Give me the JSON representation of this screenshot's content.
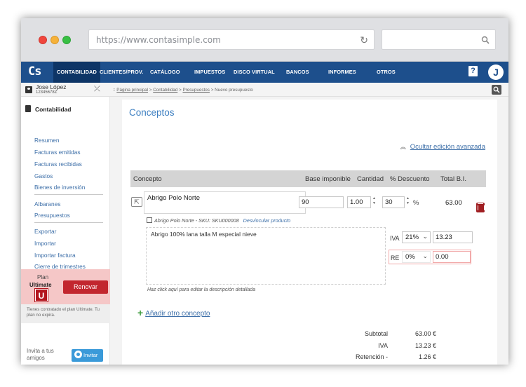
{
  "browser": {
    "url": "https://www.contasimple.com"
  },
  "nav": {
    "logo": "Cs",
    "items": [
      "CONTABILIDAD",
      "CLIENTES/PROV.",
      "CATÁLOGO",
      "IMPUESTOS",
      "DISCO VIRTUAL",
      "BANCOS",
      "INFORMES",
      "OTROS"
    ],
    "help": "?",
    "avatar": "J"
  },
  "user": {
    "name": "Jose López",
    "nif": "12345678Z"
  },
  "breadcrumb": {
    "prefix": "::",
    "home": "Página principal",
    "section": "Contabilidad",
    "sub": "Presupuestos",
    "current": "Nuevo presupuesto"
  },
  "sidebar": {
    "heading": "Contabilidad",
    "group1": [
      "Resumen",
      "Facturas emitidas",
      "Facturas recibidas",
      "Gastos",
      "Bienes de inversión"
    ],
    "group2": [
      "Albaranes",
      "Presupuestos"
    ],
    "group3": [
      "Exportar",
      "Importar",
      "Importar factura",
      "Cierre de trimestres"
    ],
    "plan_label": "Plan",
    "plan_name": "Ultimate",
    "plan_letter": "U",
    "renew": "Renovar",
    "plan_note": "Tienes contratado el plan Ultimate. Tu plan no expira.",
    "invite_text_1": "Invita a tus",
    "invite_text_2": "amigos",
    "invite_btn": "Invitar"
  },
  "main": {
    "title": "Conceptos",
    "advanced_link": "Ocultar edición avanzada",
    "columns": [
      "Concepto",
      "Base imponible",
      "Cantidad",
      "% Descuento",
      "Total B.I."
    ],
    "line": {
      "concept": "Abrigo Polo Norte",
      "base": "90",
      "quantity": "1.00",
      "discount": "30",
      "percent_sign": "%",
      "total": "63.00",
      "sku_info": "Abrigo Polo Norte - SKU: SKU000008",
      "unlink": "Desvincular producto",
      "description": "Abrigo 100% lana talla M especial nieve",
      "desc_hint": "Haz click aquí para editar la descripción detallada",
      "iva_label": "IVA",
      "iva_rate": "21%",
      "iva_amount": "13.23",
      "re_label": "RE",
      "re_rate": "0%",
      "re_amount": "0.00"
    },
    "add_concept": "Añadir otro concepto",
    "summary": [
      {
        "label": "Subtotal",
        "value": "63.00 €"
      },
      {
        "label": "IVA",
        "value": "13.23 €"
      },
      {
        "label": "Retención -",
        "value": "1.26 €"
      }
    ]
  }
}
